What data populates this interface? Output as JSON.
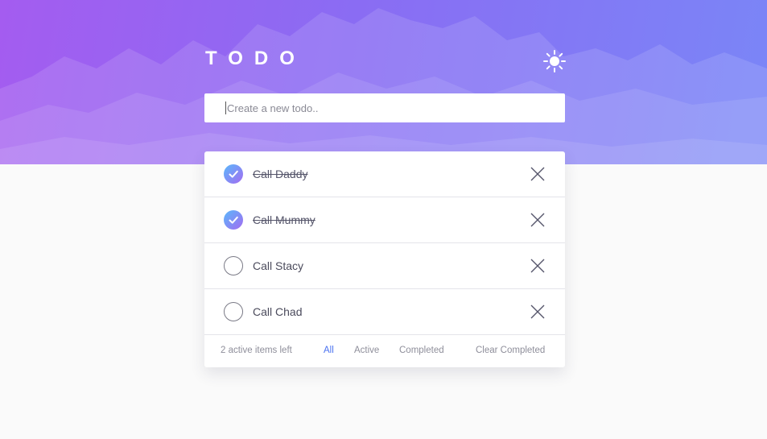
{
  "app": {
    "title": "TODO",
    "theme_icon": "sun-icon"
  },
  "new_todo": {
    "placeholder": "Create a new todo..",
    "value": ""
  },
  "todos": [
    {
      "text": "Call Daddy",
      "completed": true
    },
    {
      "text": "Call Mummy",
      "completed": true
    },
    {
      "text": "Call Stacy",
      "completed": false
    },
    {
      "text": "Call Chad",
      "completed": false
    }
  ],
  "footer": {
    "count_label": "2 active items left",
    "filter_all": "All",
    "filter_active": "Active",
    "filter_completed": "Completed",
    "active_filter": "All",
    "clear_label": "Clear Completed"
  },
  "icons": {
    "check": "check-icon",
    "delete": "close-icon",
    "theme": "sun-icon"
  },
  "colors": {
    "accent": "#4b72f0",
    "gradient_start": "#5ab8fb",
    "gradient_end": "#a46bf1",
    "hero_left": "#a45cf0",
    "hero_right": "#7a86f7"
  }
}
